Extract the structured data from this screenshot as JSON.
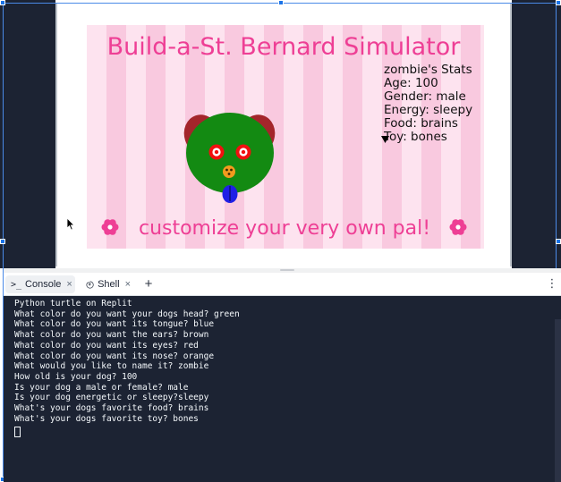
{
  "turtle": {
    "title": "Build-a-St. Bernard Simulator",
    "stats_heading": "zombie's Stats",
    "stats": [
      "Age: 100",
      "Gender: male",
      "Energy: sleepy",
      "Food: brains",
      "Toy: bones"
    ],
    "tagline": "customize your very own pal!",
    "colors": {
      "title": "#ee3f95",
      "stripe_light": "#fde3ef",
      "stripe_dark": "#f9c9df",
      "head": "#138a12",
      "ears": "#a4252b",
      "eyes": "#f20f0f",
      "nose": "#f39a1e",
      "tongue": "#1f1fe6",
      "flower": "#ee3f95"
    }
  },
  "tabs": [
    {
      "label": "Console",
      "icon": "terminal-icon"
    },
    {
      "label": "Shell",
      "icon": "shell-icon"
    }
  ],
  "tab_add": "+",
  "tab_close": "×",
  "tab_menu": "⋮",
  "console": {
    "lines": [
      "Python turtle on Replit",
      "What color do you want your dogs head? green",
      "What color do you want its tongue? blue",
      "What color do you want the ears? brown",
      "What color do you want its eyes? red",
      "What color do you want its nose? orange",
      "What would you like to name it? zombie",
      "How old is your dog? 100",
      "Is your dog a male or female? male",
      "Is your dog energetic or sleepy?sleepy",
      "What's your dogs favorite food? brains",
      "What's your dogs favorite toy? bones"
    ]
  }
}
